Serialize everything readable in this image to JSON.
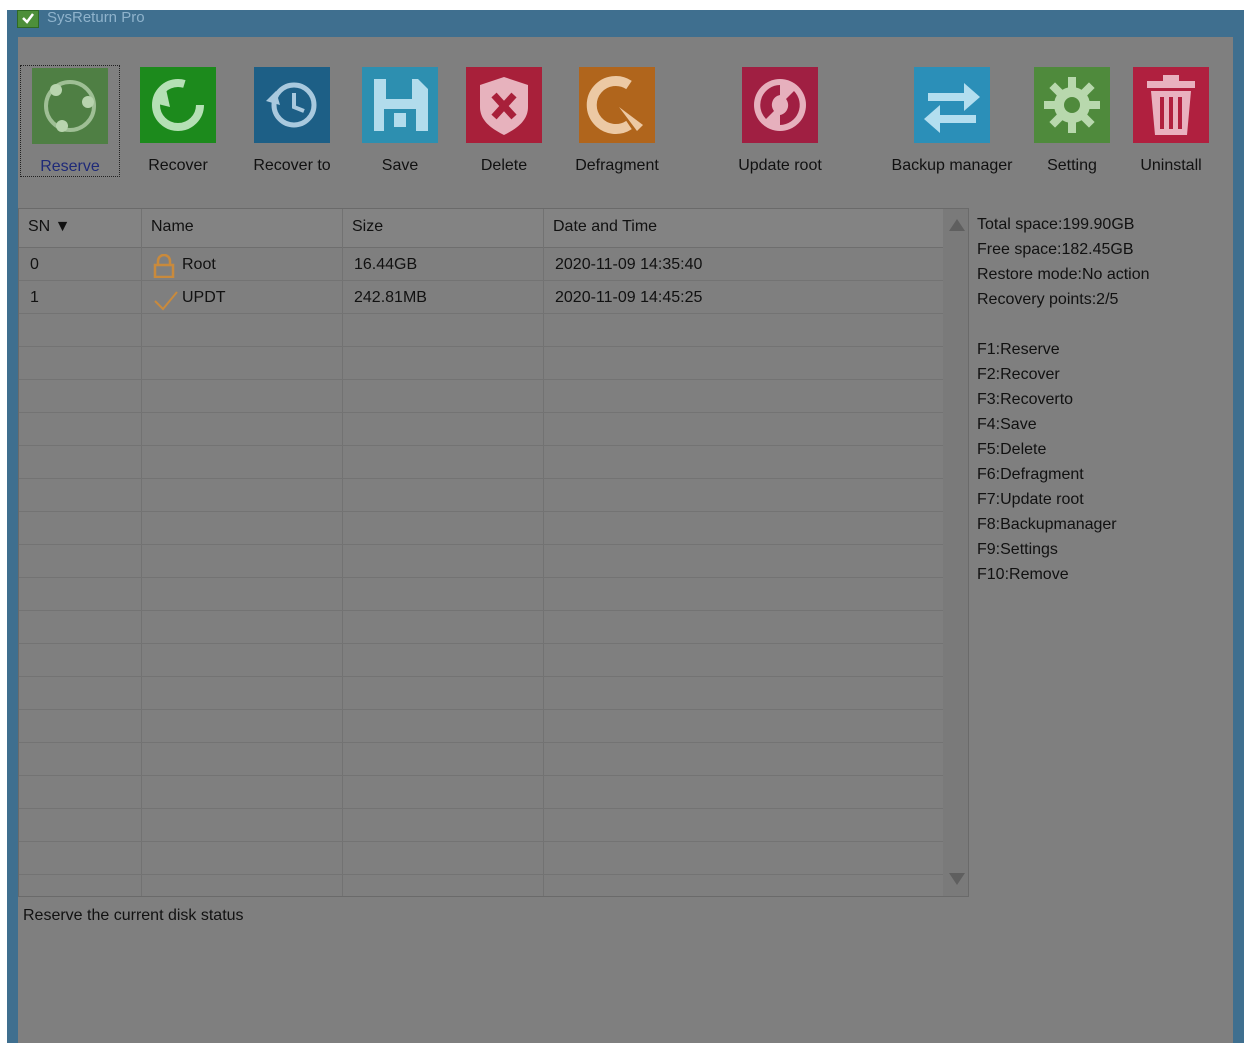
{
  "window": {
    "title": "SysReturn Pro"
  },
  "toolbar": {
    "buttons": [
      {
        "label": "Reserve",
        "icon": "reserve-icon",
        "color": "#4f7f44"
      },
      {
        "label": "Recover",
        "icon": "recover-icon",
        "color": "#1c8a1c"
      },
      {
        "label": "Recover to",
        "icon": "recover-to-icon",
        "color": "#1d5f86"
      },
      {
        "label": "Save",
        "icon": "save-icon",
        "color": "#2d8fb0"
      },
      {
        "label": "Delete",
        "icon": "delete-icon",
        "color": "#a8203a"
      },
      {
        "label": "Defragment",
        "icon": "defragment-icon",
        "color": "#b0651c"
      },
      {
        "label": "Update root",
        "icon": "update-root-icon",
        "color": "#a01f42"
      },
      {
        "label": "Backup manager",
        "icon": "backup-manager-icon",
        "color": "#2b8fb8"
      },
      {
        "label": "Setting",
        "icon": "gear-icon",
        "color": "#4f8a3c"
      },
      {
        "label": "Uninstall",
        "icon": "trash-icon",
        "color": "#b0203f"
      }
    ]
  },
  "table": {
    "columns": [
      "SN ▼",
      "Name",
      "Size",
      "Date and Time"
    ],
    "rows": [
      {
        "sn": "0",
        "name": "Root",
        "icon": "lock-icon",
        "size": "16.44GB",
        "datetime": "2020-11-09 14:35:40"
      },
      {
        "sn": "1",
        "name": "UPDT",
        "icon": "checkmark-icon",
        "size": "242.81MB",
        "datetime": "2020-11-09 14:45:25"
      }
    ]
  },
  "info": {
    "total_space": "Total space:199.90GB",
    "free_space": "Free space:182.45GB",
    "restore_mode": "Restore mode:No action",
    "recovery_points": "Recovery points:2/5",
    "shortcuts": [
      "F1:Reserve",
      "F2:Recover",
      "F3:Recoverto",
      "F4:Save",
      "F5:Delete",
      "F6:Defragment",
      "F7:Update root",
      "F8:Backupmanager",
      "F9:Settings",
      "F10:Remove"
    ]
  },
  "status": {
    "text": "Reserve the current disk status"
  }
}
